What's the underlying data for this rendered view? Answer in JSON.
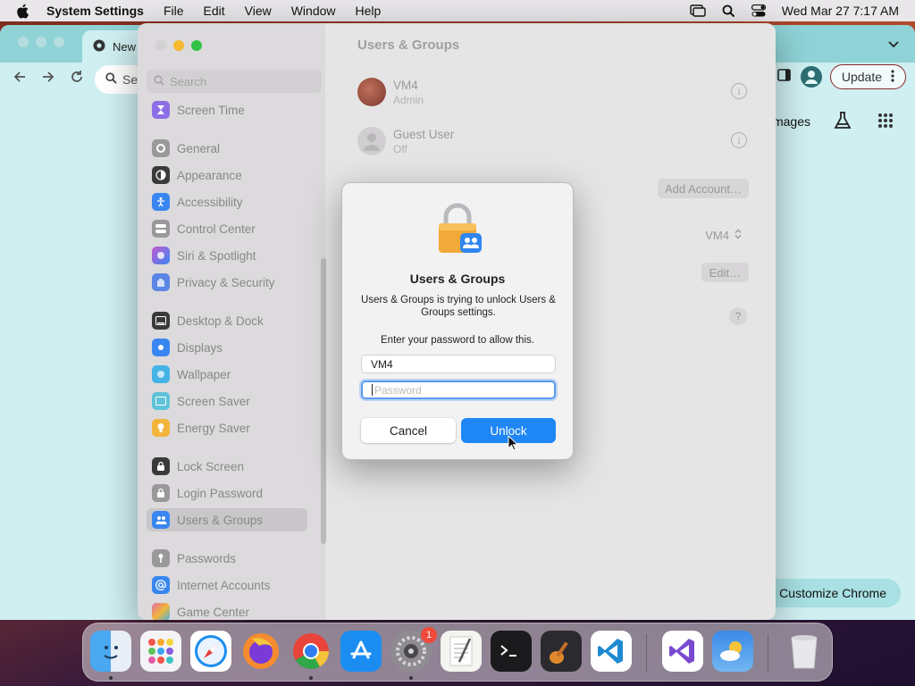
{
  "menubar": {
    "app_name": "System Settings",
    "menus": [
      "File",
      "Edit",
      "View",
      "Window",
      "Help"
    ],
    "datetime": "Wed Mar 27  7:17 AM"
  },
  "chrome": {
    "tab_title": "New",
    "omnibox_text": "Se",
    "update_label": "Update",
    "images_label": "mages",
    "customize_label": "Customize Chrome"
  },
  "settings": {
    "window_title": "Users & Groups",
    "search_placeholder": "Search",
    "sidebar": [
      {
        "label": "Screen Time",
        "icon": "hourglass-icon",
        "color": "#8e6ee6"
      },
      {
        "label": "General",
        "icon": "gear-icon",
        "color": "#9a989a"
      },
      {
        "label": "Appearance",
        "icon": "appearance-icon",
        "color": "#3a3a3a"
      },
      {
        "label": "Accessibility",
        "icon": "accessibility-icon",
        "color": "#3a86f0"
      },
      {
        "label": "Control Center",
        "icon": "control-center-icon",
        "color": "#9a989a"
      },
      {
        "label": "Siri & Spotlight",
        "icon": "siri-icon",
        "color": "#c45ad0"
      },
      {
        "label": "Privacy & Security",
        "icon": "hand-icon",
        "color": "#5b86e5"
      },
      {
        "label": "Desktop & Dock",
        "icon": "dock-icon",
        "color": "#3a3a3a"
      },
      {
        "label": "Displays",
        "icon": "display-icon",
        "color": "#3a86f0"
      },
      {
        "label": "Wallpaper",
        "icon": "wallpaper-icon",
        "color": "#46b3e6"
      },
      {
        "label": "Screen Saver",
        "icon": "screensaver-icon",
        "color": "#5ec3d8"
      },
      {
        "label": "Energy Saver",
        "icon": "bulb-icon",
        "color": "#f2b53a"
      },
      {
        "label": "Lock Screen",
        "icon": "lock-icon",
        "color": "#3a3a3a"
      },
      {
        "label": "Login Password",
        "icon": "lock-icon",
        "color": "#9a989a"
      },
      {
        "label": "Users & Groups",
        "icon": "users-icon",
        "color": "#3a86f0"
      },
      {
        "label": "Passwords",
        "icon": "key-icon",
        "color": "#9a989a"
      },
      {
        "label": "Internet Accounts",
        "icon": "at-icon",
        "color": "#3a86f0"
      },
      {
        "label": "Game Center",
        "icon": "game-center-icon",
        "color": "#e06aa8"
      }
    ],
    "users": [
      {
        "name": "VM4",
        "role": "Admin"
      },
      {
        "name": "Guest User",
        "role": "Off"
      }
    ],
    "add_account_label": "Add Account…",
    "auto_login_value": "VM4",
    "edit_label": "Edit…",
    "help_label": "?"
  },
  "dialog": {
    "title": "Users & Groups",
    "message": "Users & Groups is trying to unlock Users & Groups settings.",
    "prompt": "Enter your password to allow this.",
    "username_value": "VM4",
    "password_placeholder": "Password",
    "cancel_label": "Cancel",
    "unlock_label": "Unlock"
  },
  "dock": {
    "settings_badge": "1"
  }
}
